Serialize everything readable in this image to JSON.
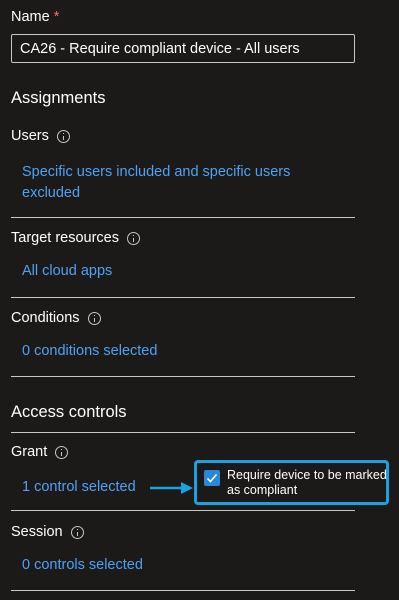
{
  "name": {
    "label": "Name",
    "required_mark": "*",
    "value": "CA26 - Require compliant device - All users"
  },
  "assignments": {
    "heading": "Assignments",
    "users": {
      "label": "Users",
      "link": "Specific users included and specific users excluded"
    },
    "target_resources": {
      "label": "Target resources",
      "link": "All cloud apps"
    },
    "conditions": {
      "label": "Conditions",
      "link": "0 conditions selected"
    }
  },
  "access_controls": {
    "heading": "Access controls",
    "grant": {
      "label": "Grant",
      "link": "1 control selected"
    },
    "session": {
      "label": "Session",
      "link": "0 controls selected"
    }
  },
  "callout": {
    "checked": true,
    "text": "Require device to be marked as compliant"
  },
  "colors": {
    "background": "#1b1a19",
    "link": "#4ea1f5",
    "required": "#f1707b",
    "callout_border": "#1ba1e2",
    "checkbox": "#2b88d8"
  },
  "icons": [
    "info-icon",
    "checkmark-icon",
    "arrow-right-icon"
  ]
}
